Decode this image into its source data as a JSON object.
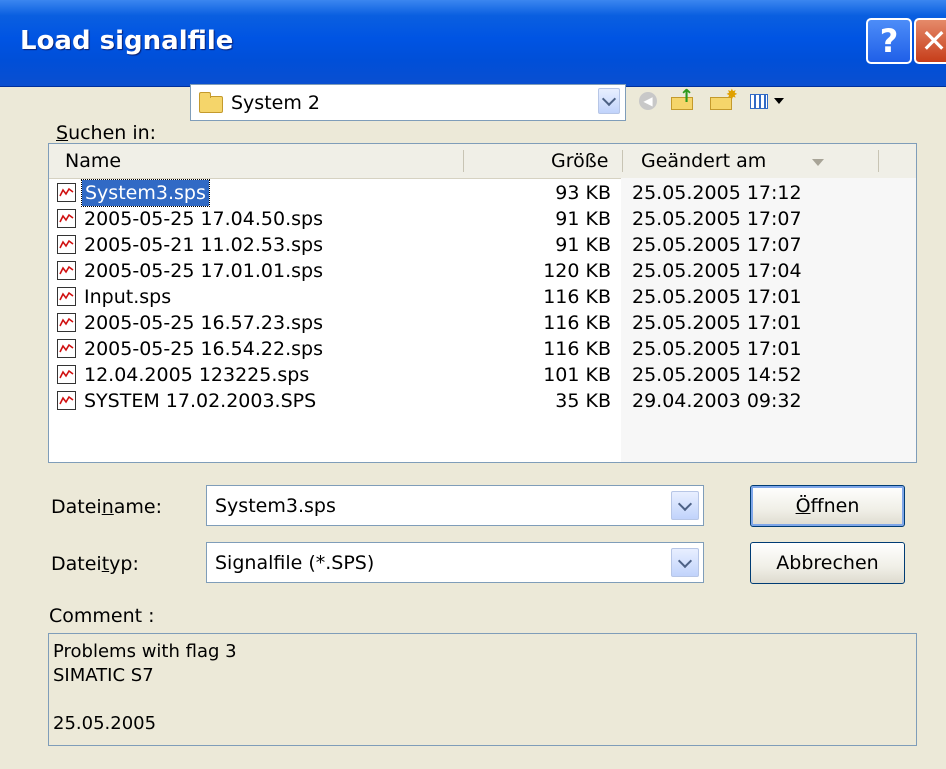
{
  "window": {
    "title": "Load signalfile"
  },
  "lookin": {
    "label_prefix": "",
    "label_accel": "S",
    "label_rest": "uchen in:",
    "value": "System 2"
  },
  "columns": {
    "name": "Name",
    "size": "Größe",
    "modified": "Geändert am"
  },
  "files": [
    {
      "name": "System3.sps",
      "size": "93 KB",
      "modified": "25.05.2005 17:12",
      "selected": true
    },
    {
      "name": "2005-05-25 17.04.50.sps",
      "size": "91 KB",
      "modified": "25.05.2005 17:07"
    },
    {
      "name": "2005-05-21 11.02.53.sps",
      "size": "91 KB",
      "modified": "25.05.2005 17:07"
    },
    {
      "name": "2005-05-25 17.01.01.sps",
      "size": "120 KB",
      "modified": "25.05.2005 17:04"
    },
    {
      "name": "Input.sps",
      "size": "116 KB",
      "modified": "25.05.2005 17:01"
    },
    {
      "name": "2005-05-25 16.57.23.sps",
      "size": "116 KB",
      "modified": "25.05.2005 17:01"
    },
    {
      "name": "2005-05-25 16.54.22.sps",
      "size": "116 KB",
      "modified": "25.05.2005 17:01"
    },
    {
      "name": "12.04.2005 123225.sps",
      "size": "101 KB",
      "modified": "25.05.2005 14:52"
    },
    {
      "name": "SYSTEM 17.02.2003.SPS",
      "size": "35 KB",
      "modified": "29.04.2003 09:32"
    }
  ],
  "filename": {
    "label_prefix": "Datei",
    "label_accel": "n",
    "label_rest": "ame:",
    "value": "System3.sps"
  },
  "filetype": {
    "label_prefix": "Datei",
    "label_accel": "t",
    "label_rest": "yp:",
    "value": "Signalfile (*.SPS)"
  },
  "buttons": {
    "open_accel": "Ö",
    "open_rest": "ffnen",
    "cancel": "Abbrechen"
  },
  "comment": {
    "label": "Comment :",
    "lines": [
      "Problems with flag 3",
      "SIMATIC S7",
      "",
      "25.05.2005"
    ]
  },
  "colors": {
    "titlebar": "#0054e3",
    "selection": "#316ac5",
    "dialog_bg": "#ece9d8",
    "close_button": "#c63d1a"
  }
}
